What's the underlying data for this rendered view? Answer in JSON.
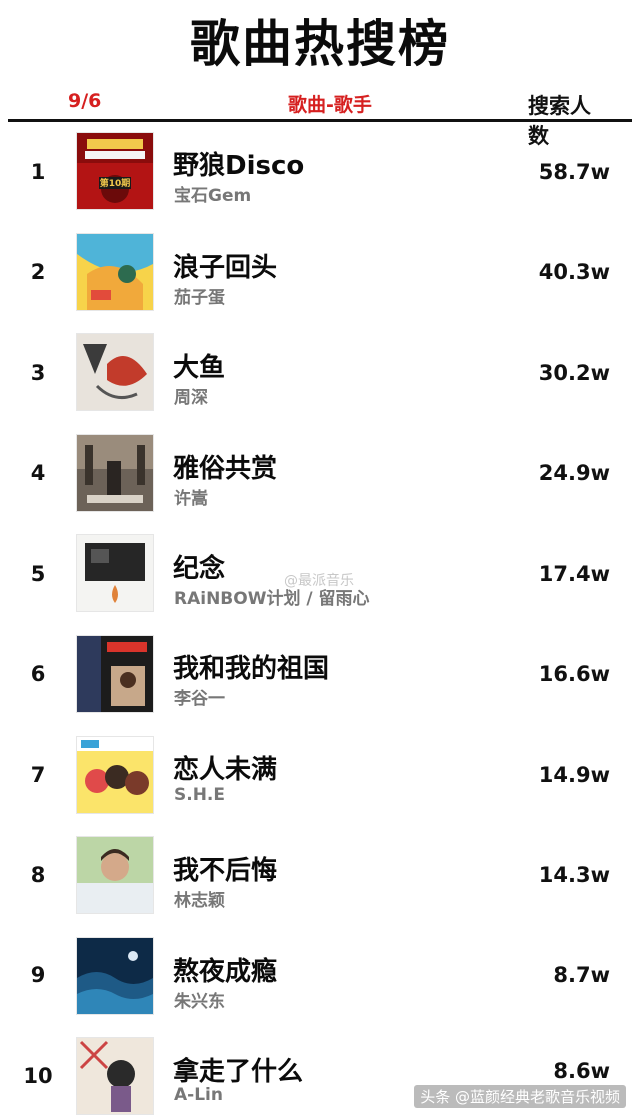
{
  "title": "歌曲热搜榜",
  "header": {
    "date": "9/6",
    "song_column": "歌曲-歌手",
    "count_column": "搜索人数"
  },
  "colors": {
    "accent": "#d62020",
    "text": "#111111",
    "artist": "#777777"
  },
  "rows": [
    {
      "rank": "1",
      "song": "野狼Disco",
      "artist": "宝石Gem",
      "count": "58.7w",
      "cover_text": "第10期"
    },
    {
      "rank": "2",
      "song": "浪子回头",
      "artist": "茄子蛋",
      "count": "40.3w"
    },
    {
      "rank": "3",
      "song": "大鱼",
      "artist": "周深",
      "count": "30.2w"
    },
    {
      "rank": "4",
      "song": "雅俗共赏",
      "artist": "许嵩",
      "count": "24.9w"
    },
    {
      "rank": "5",
      "song": "纪念",
      "artist": "RAiNBOW计划 / 留雨心",
      "count": "17.4w"
    },
    {
      "rank": "6",
      "song": "我和我的祖国",
      "artist": "李谷一",
      "count": "16.6w"
    },
    {
      "rank": "7",
      "song": "恋人未满",
      "artist": "S.H.E",
      "count": "14.9w"
    },
    {
      "rank": "8",
      "song": "我不后悔",
      "artist": "林志颖",
      "count": "14.3w"
    },
    {
      "rank": "9",
      "song": "熬夜成瘾",
      "artist": "朱兴东",
      "count": "8.7w"
    },
    {
      "rank": "10",
      "song": "拿走了什么",
      "artist": "A-Lin",
      "count": "8.6w"
    }
  ],
  "watermark": "@最派音乐",
  "footer": "头条 @蓝颜经典老歌音乐视频"
}
